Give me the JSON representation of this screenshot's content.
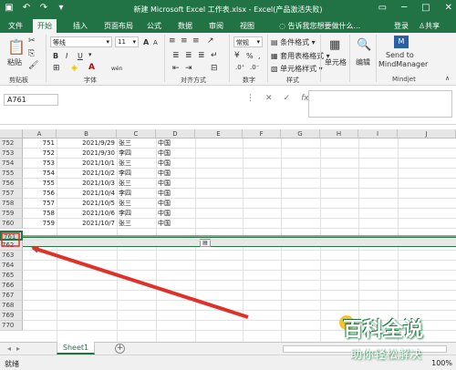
{
  "window": {
    "title": "新建 Microsoft Excel 工作表.xlsx - Excel(产品激活失败)",
    "quick_access": [
      "save",
      "undo",
      "redo",
      "customize"
    ]
  },
  "tabs": [
    {
      "label": "文件",
      "active": false
    },
    {
      "label": "开始",
      "active": true
    },
    {
      "label": "插入",
      "active": false
    },
    {
      "label": "页面布局",
      "active": false
    },
    {
      "label": "公式",
      "active": false
    },
    {
      "label": "数据",
      "active": false
    },
    {
      "label": "审阅",
      "active": false
    },
    {
      "label": "视图",
      "active": false
    }
  ],
  "tell_me": "告诉我您想要做什么...",
  "account": {
    "login": "登录",
    "share": "共享"
  },
  "ribbon": {
    "clipboard": {
      "label": "剪贴板",
      "paste": "粘贴"
    },
    "font": {
      "label": "字体",
      "name": "等线",
      "size": "11",
      "bold": "B",
      "italic": "I",
      "underline": "U",
      "grow": "A",
      "shrink": "A",
      "wen": "wén"
    },
    "alignment": {
      "label": "对齐方式"
    },
    "number": {
      "label": "数字",
      "format": "常规",
      "percent": "%",
      "comma": ","
    },
    "styles": {
      "label": "样式",
      "conditional": "条件格式",
      "table": "套用表格格式",
      "cell": "单元格样式"
    },
    "cells": {
      "label": "单元格"
    },
    "editing": {
      "label": "编辑"
    },
    "mindjet": {
      "label": "Mindjet",
      "send_line1": "Send to",
      "send_line2": "MindManager"
    }
  },
  "formula_bar": {
    "name_box": "A761",
    "value": ""
  },
  "columns": [
    "A",
    "B",
    "C",
    "D",
    "E",
    "F",
    "G",
    "H",
    "I",
    "J"
  ],
  "rows": [
    {
      "num": "752",
      "a": "751",
      "b": "2021/9/29",
      "c": "张三",
      "d": "中国"
    },
    {
      "num": "753",
      "a": "752",
      "b": "2021/9/30",
      "c": "李四",
      "d": "中国"
    },
    {
      "num": "754",
      "a": "753",
      "b": "2021/10/1",
      "c": "张三",
      "d": "中国"
    },
    {
      "num": "755",
      "a": "754",
      "b": "2021/10/2",
      "c": "李四",
      "d": "中国"
    },
    {
      "num": "756",
      "a": "755",
      "b": "2021/10/3",
      "c": "张三",
      "d": "中国"
    },
    {
      "num": "757",
      "a": "756",
      "b": "2021/10/4",
      "c": "李四",
      "d": "中国"
    },
    {
      "num": "758",
      "a": "757",
      "b": "2021/10/5",
      "c": "张三",
      "d": "中国"
    },
    {
      "num": "759",
      "a": "758",
      "b": "2021/10/6",
      "c": "李四",
      "d": "中国"
    },
    {
      "num": "760",
      "a": "759",
      "b": "2021/10/7",
      "c": "张三",
      "d": "中国"
    },
    {
      "num": "761",
      "a": "",
      "b": "",
      "c": "",
      "d": ""
    },
    {
      "num": "762",
      "a": "",
      "b": "",
      "c": "",
      "d": ""
    },
    {
      "num": "763",
      "a": "",
      "b": "",
      "c": "",
      "d": ""
    },
    {
      "num": "764",
      "a": "",
      "b": "",
      "c": "",
      "d": ""
    },
    {
      "num": "765",
      "a": "",
      "b": "",
      "c": "",
      "d": ""
    },
    {
      "num": "766",
      "a": "",
      "b": "",
      "c": "",
      "d": ""
    },
    {
      "num": "767",
      "a": "",
      "b": "",
      "c": "",
      "d": ""
    },
    {
      "num": "768",
      "a": "",
      "b": "",
      "c": "",
      "d": ""
    },
    {
      "num": "769",
      "a": "",
      "b": "",
      "c": "",
      "d": ""
    },
    {
      "num": "770",
      "a": "",
      "b": "",
      "c": "",
      "d": ""
    }
  ],
  "sheets": [
    {
      "label": "Sheet1",
      "active": true
    }
  ],
  "status": {
    "text": "就绪",
    "zoom": "100%"
  },
  "watermark": {
    "main": "百科全说",
    "sub": "助你轻松解决"
  },
  "colors": {
    "accent": "#217346",
    "arrow": "#e0302a"
  }
}
